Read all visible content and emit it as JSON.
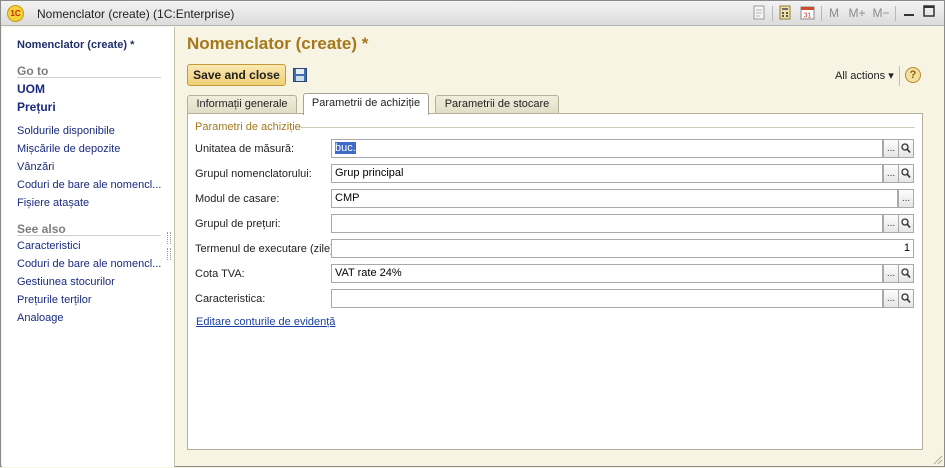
{
  "window": {
    "title": "Nomenclator (create)  (1C:Enterprise)",
    "logo_text": "1C",
    "toolbar_icons": [
      "document-icon",
      "calculator-icon",
      "calendar-icon",
      "memory-m-icon",
      "memory-plus-icon",
      "memory-minus-icon",
      "minimize-icon",
      "maximize-icon",
      "close-icon"
    ],
    "memory_labels": {
      "m": "M",
      "m_plus": "M+",
      "m_minus": "M−"
    },
    "calendar_day": "31"
  },
  "nav": {
    "form_title": "Nomenclator (create) *",
    "goto_heading": "Go to",
    "goto_strong": [
      "UOM",
      "Prețuri"
    ],
    "goto_links": [
      "Soldurile disponibile",
      "Mișcările de depozite",
      "Vânzări",
      "Coduri de bare ale nomencl...",
      "Fișiere atașate"
    ],
    "seealso_heading": "See also",
    "seealso_links": [
      "Caracteristici",
      "Coduri de bare ale nomencl...",
      "Gestiunea stocurilor",
      "Prețurile terților",
      "Analoage"
    ]
  },
  "main": {
    "title": "Nomenclator (create) *",
    "save_close_label": "Save and close",
    "all_actions_label": "All actions ▾",
    "help_label": "?",
    "tabs": [
      {
        "label": "Informații generale",
        "active": false
      },
      {
        "label": "Parametrii de achiziție",
        "active": true
      },
      {
        "label": "Parametrii de stocare",
        "active": false
      }
    ],
    "group_title": "Parametri de achiziție",
    "fields": [
      {
        "label": "Unitatea de măsură:",
        "value": "buc.",
        "selected": true,
        "buttons": [
          "...",
          "search"
        ]
      },
      {
        "label": "Grupul nomenclatorului:",
        "value": "Grup principal",
        "buttons": [
          "...",
          "search"
        ]
      },
      {
        "label": "Modul de casare:",
        "value": "CMP",
        "buttons": [
          "..."
        ]
      },
      {
        "label": "Grupul de prețuri:",
        "value": "",
        "buttons": [
          "...",
          "search"
        ]
      },
      {
        "label": "Termenul de executare (zile):",
        "value": "1",
        "align": "right",
        "buttons": []
      },
      {
        "label": "Cota TVA:",
        "value": "VAT rate 24%",
        "buttons": [
          "...",
          "search"
        ]
      },
      {
        "label": "Caracteristica:",
        "value": "",
        "buttons": [
          "...",
          "search"
        ]
      }
    ],
    "edit_link": "Editare conturile de evidență"
  }
}
